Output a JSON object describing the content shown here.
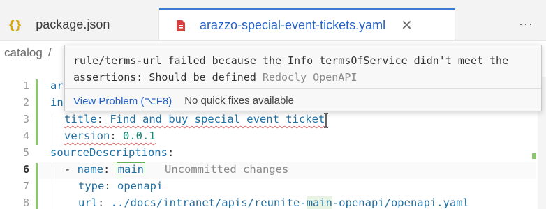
{
  "tabs": [
    {
      "icon": "json-braces-icon",
      "label": "package.json",
      "active": false
    },
    {
      "icon": "yaml-file-icon",
      "label": "arazzo-special-event-tickets.yaml",
      "active": true
    }
  ],
  "tab_close_symbol": "✕",
  "more_actions_symbol": "···",
  "breadcrumb": {
    "first": "catalog",
    "separator": "/"
  },
  "editor": {
    "line_numbers": [
      "1",
      "2",
      "3",
      "4",
      "5",
      "6",
      "7",
      "8"
    ],
    "active_line": "6",
    "lines": {
      "l1_key": "ar",
      "l2_key": "in",
      "l3_key": "title",
      "l3_value": "Find and buy special event ticket",
      "l4_key": "version",
      "l4_value": "0.0.1",
      "l5_key": "sourceDescriptions",
      "l6_dash": "- ",
      "l6_key": "name",
      "l6_value": "main",
      "l6_ghost": "Uncommitted changes",
      "l7_key": "type",
      "l7_value": "openapi",
      "l8_key": "url",
      "l8_value_a": "../docs/intranet/apis/reunite-",
      "l8_value_b": "main",
      "l8_value_c": "-openapi/openapi.yaml"
    }
  },
  "hover": {
    "message": "rule/terms-url failed because the Info termsOfService didn't meet the assertions: Should be defined",
    "source": "Redocly OpenAPI",
    "view_problem": "View Problem (⌥F8)",
    "no_fixes": "No quick fixes available"
  },
  "colors": {
    "accent": "#3f7bd6",
    "link": "#2462c5",
    "added": "#8cc66f",
    "error_squiggle": "#e06767"
  }
}
